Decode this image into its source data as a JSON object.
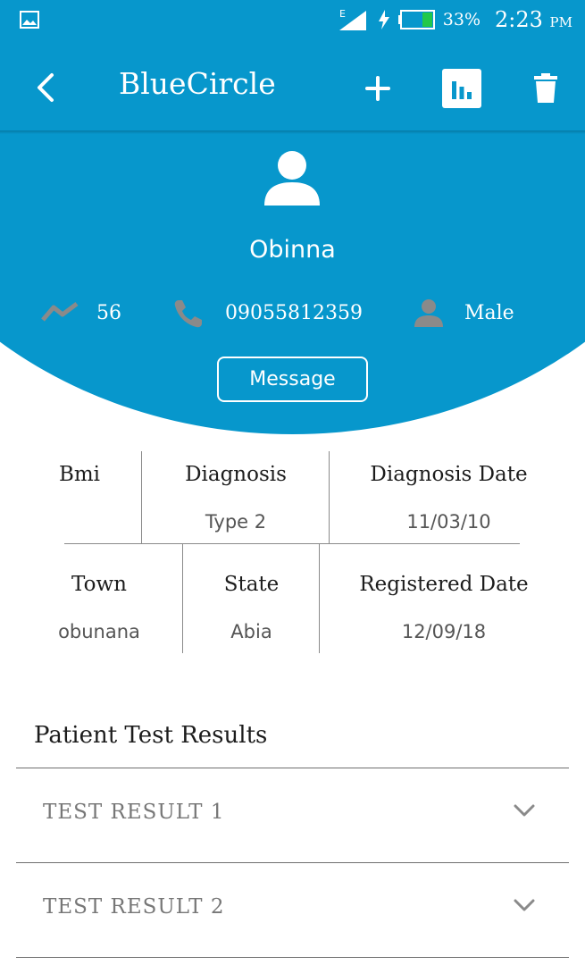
{
  "status_bar": {
    "network": "E",
    "battery": "33%",
    "time": "2:23",
    "ampm": "PM"
  },
  "toolbar": {
    "title": "BlueCircle",
    "back_icon": "chevron-left-icon",
    "add_icon": "plus-icon",
    "chart_icon": "bar-chart-icon",
    "delete_icon": "trash-icon"
  },
  "profile": {
    "name": "Obinna",
    "age": "56",
    "phone": "09055812359",
    "gender": "Male",
    "message_label": "Message"
  },
  "info": {
    "row1": [
      {
        "label": "Bmi",
        "value": ""
      },
      {
        "label": "Diagnosis",
        "value": "Type 2"
      },
      {
        "label": "Diagnosis Date",
        "value": "11/03/10"
      }
    ],
    "row2": [
      {
        "label": "Town",
        "value": "obunana"
      },
      {
        "label": "State",
        "value": "Abia"
      },
      {
        "label": "Registered Date",
        "value": "12/09/18"
      }
    ]
  },
  "results": {
    "title": "Patient Test Results",
    "items": [
      {
        "label": "TEST RESULT 1"
      },
      {
        "label": "TEST RESULT 2"
      }
    ]
  },
  "colors": {
    "primary": "#0797cc",
    "icon_grey": "#8a8a8a"
  }
}
